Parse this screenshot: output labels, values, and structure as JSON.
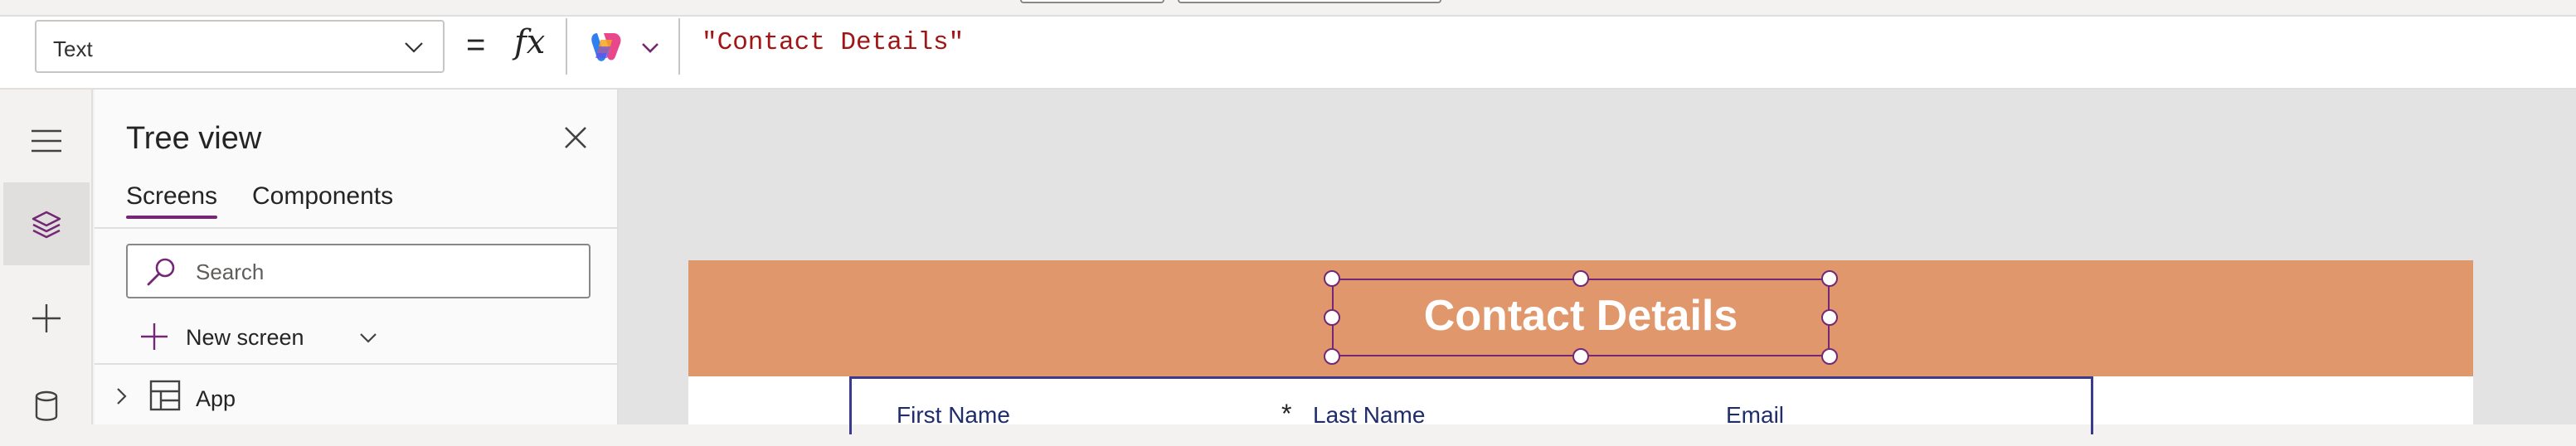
{
  "formula_bar": {
    "property": "Text",
    "equals": "=",
    "fx_label": "fx",
    "formula": "\"Contact Details\""
  },
  "left_rail": {
    "items": [
      {
        "name": "hamburger-menu",
        "icon": "hamburger-icon",
        "active": false
      },
      {
        "name": "tree-view",
        "icon": "layers-icon",
        "active": true
      },
      {
        "name": "insert",
        "icon": "plus-icon",
        "active": false
      },
      {
        "name": "data",
        "icon": "database-icon",
        "active": false
      }
    ]
  },
  "tree_view": {
    "title": "Tree view",
    "tabs": [
      {
        "label": "Screens",
        "active": true
      },
      {
        "label": "Components",
        "active": false
      }
    ],
    "search_placeholder": "Search",
    "new_screen_label": "New screen",
    "nodes": [
      {
        "label": "App",
        "icon": "app-icon",
        "expanded": false
      }
    ]
  },
  "canvas": {
    "header_title": "Contact Details",
    "header_color": "#e0976c",
    "form_fields": [
      {
        "label": "First Name",
        "required": true
      },
      {
        "label": "Last Name",
        "required": false
      },
      {
        "label": "Email",
        "required": false
      }
    ],
    "required_marker": "*"
  },
  "colors": {
    "accent": "#742774",
    "formula_string": "#a31515",
    "form_border": "#3b3a8f"
  }
}
